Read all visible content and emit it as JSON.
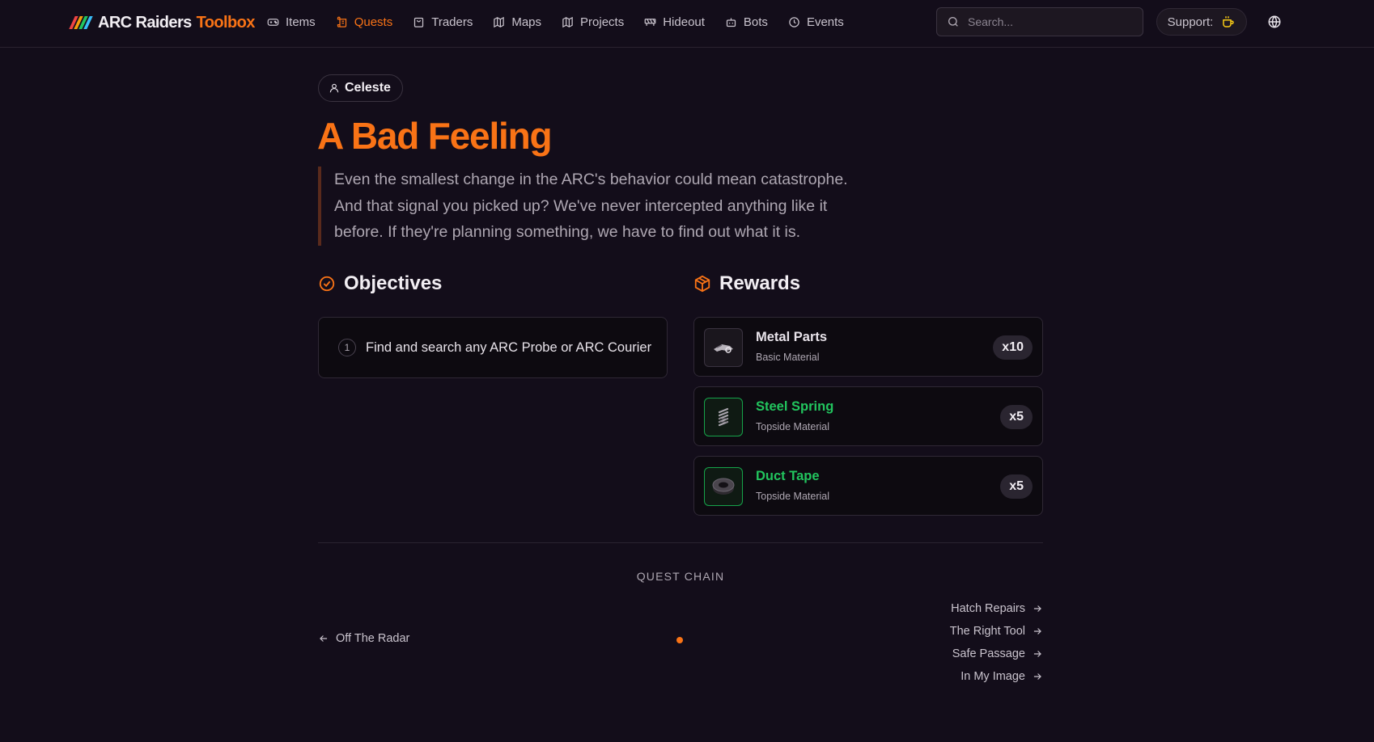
{
  "nav": {
    "logo_white": "ARC Raiders",
    "logo_orange": "Toolbox",
    "links": [
      {
        "label": "Items",
        "icon": "gamepad-icon"
      },
      {
        "label": "Quests",
        "icon": "scroll-icon",
        "active": true
      },
      {
        "label": "Traders",
        "icon": "bag-icon"
      },
      {
        "label": "Maps",
        "icon": "map-icon"
      },
      {
        "label": "Projects",
        "icon": "map-icon"
      },
      {
        "label": "Hideout",
        "icon": "hideout-icon"
      },
      {
        "label": "Bots",
        "icon": "bot-icon"
      },
      {
        "label": "Events",
        "icon": "clock-icon"
      }
    ],
    "search_placeholder": "Search...",
    "support_label": "Support:"
  },
  "quest": {
    "giver": "Celeste",
    "title": "A Bad Feeling",
    "description": "Even the smallest change in the ARC's behavior could mean catastrophe. And that signal you picked up? We've never intercepted anything like it before. If they're planning something, we have to find out what it is."
  },
  "objectives": {
    "heading": "Objectives",
    "items": [
      {
        "number": "1",
        "text": "Find and search any ARC Probe or ARC Courier"
      }
    ]
  },
  "rewards": {
    "heading": "Rewards",
    "items": [
      {
        "name": "Metal Parts",
        "type": "Basic Material",
        "qty": "x10",
        "rarity_color": "#e8e3ea"
      },
      {
        "name": "Steel Spring",
        "type": "Topside Material",
        "qty": "x5",
        "rarity_color": "#22c55e"
      },
      {
        "name": "Duct Tape",
        "type": "Topside Material",
        "qty": "x5",
        "rarity_color": "#22c55e"
      }
    ]
  },
  "chain": {
    "heading": "QUEST CHAIN",
    "previous": "Off The Radar",
    "next": [
      "Hatch Repairs",
      "The Right Tool",
      "Safe Passage",
      "In My Image"
    ]
  },
  "colors": {
    "accent": "#f97316",
    "background": "#130d1a",
    "uncommon": "#22c55e"
  }
}
